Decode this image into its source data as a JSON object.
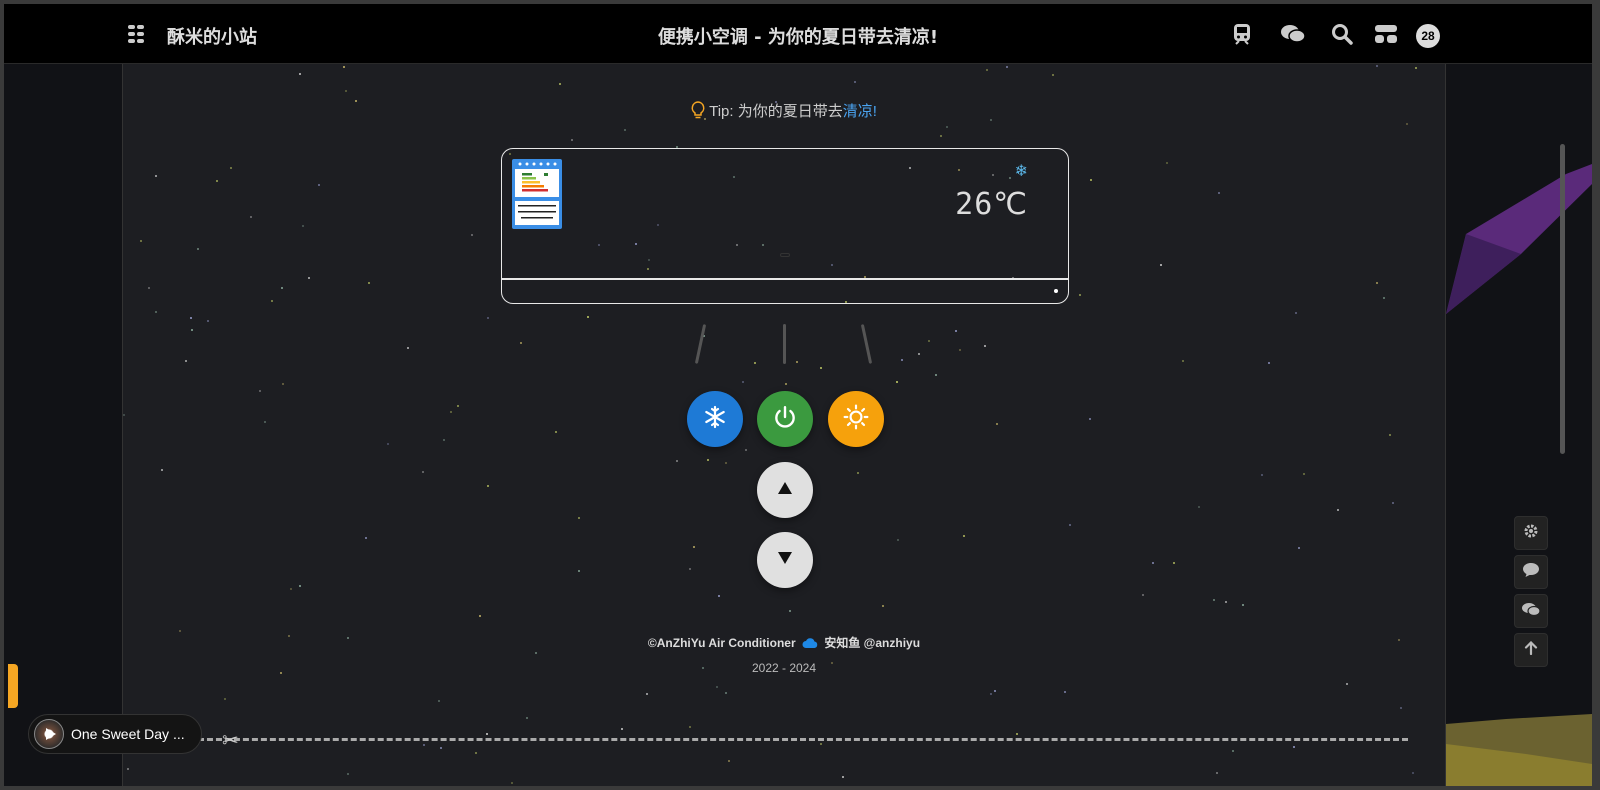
{
  "nav": {
    "site_name": "酥米的小站",
    "page_title": "便携小空调 - 为你的夏日带去清凉!",
    "badge_count": "28",
    "icons": [
      "apps-icon",
      "train-icon",
      "wechat-icon",
      "search-icon",
      "layout-icon"
    ]
  },
  "tip": {
    "prefix": "Tip: 为你的夏日带去",
    "link": "清凉!"
  },
  "ac": {
    "temperature": "26℃",
    "mode_icon": "snowflake-icon"
  },
  "controls": {
    "cool_color": "#1e7ad6",
    "power_color": "#3b9a3f",
    "heat_color": "#f6a10c",
    "arrow_color": "#e0e0e0"
  },
  "footer": {
    "copyright": "©AnZhiYu Air Conditioner",
    "author": "安知鱼 @anzhiyu",
    "years": "2022 - 2024"
  },
  "player": {
    "song": "One Sweet Day ..."
  }
}
